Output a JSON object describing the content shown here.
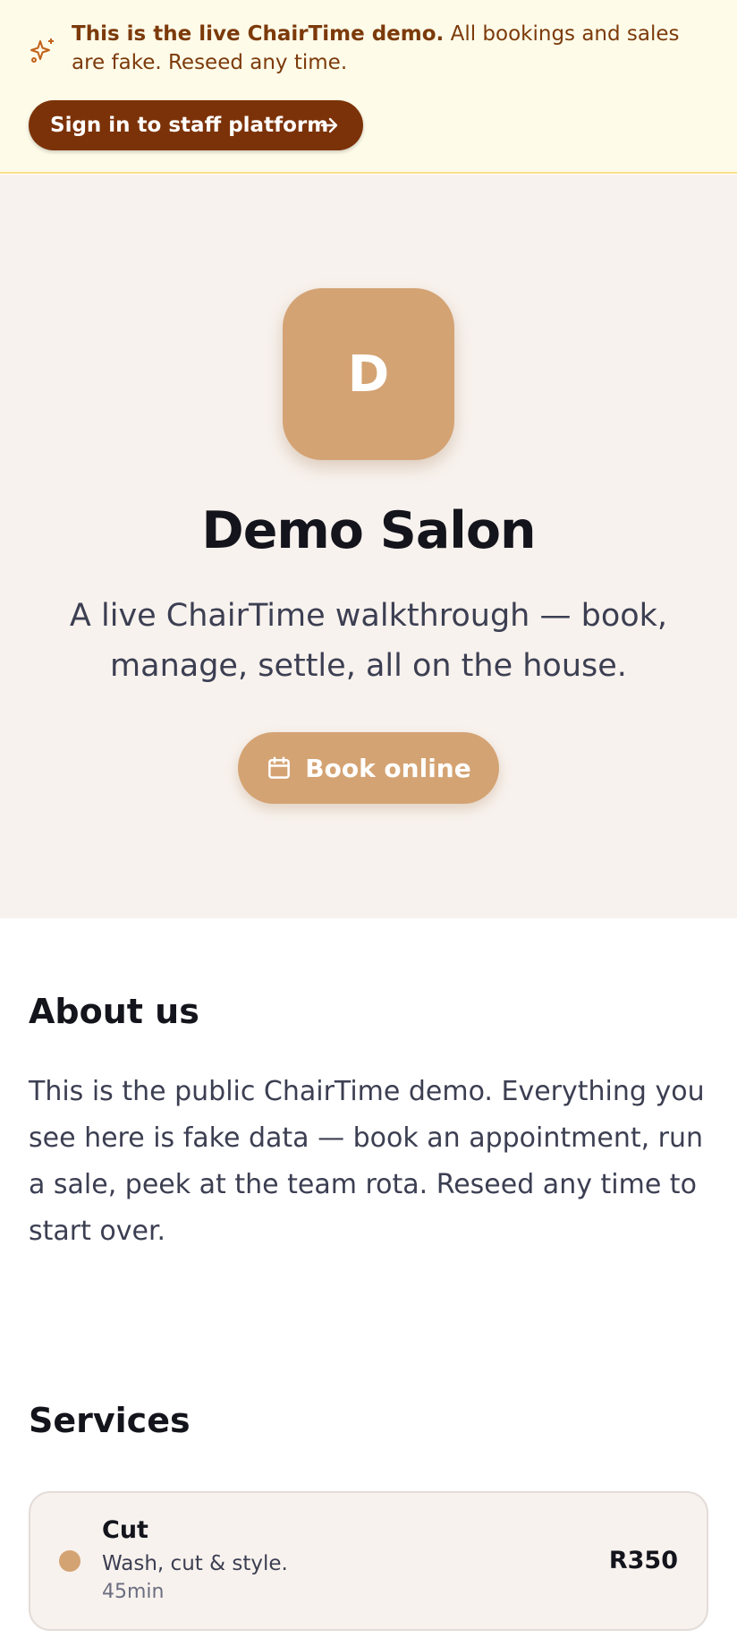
{
  "banner": {
    "bold_text": "This is the live ChairTime demo.",
    "text": " All bookings and sales are fake. Reseed any time.",
    "signin_label": "Sign in to staff platform",
    "icon": "sparkles-icon",
    "bg_color": "#fefbe9",
    "text_color": "#7c3a0a",
    "button_color": "#7c3208"
  },
  "hero": {
    "logo_letter": "D",
    "salon_name": "Demo Salon",
    "tagline": "A live ChairTime walkthrough — book, manage, settle, all on the house.",
    "book_label": "Book online",
    "accent_color": "#d4a373",
    "bg_color": "#f8f2ee"
  },
  "about": {
    "title": "About us",
    "text": "This is the public ChairTime demo. Everything you see here is fake data — book an appointment, run a sale, peek at the team rota. Reseed any time to start over."
  },
  "services": {
    "title": "Services",
    "items": [
      {
        "name": "Cut",
        "description": "Wash, cut & style.",
        "duration": "45min",
        "price": "R350"
      }
    ]
  }
}
